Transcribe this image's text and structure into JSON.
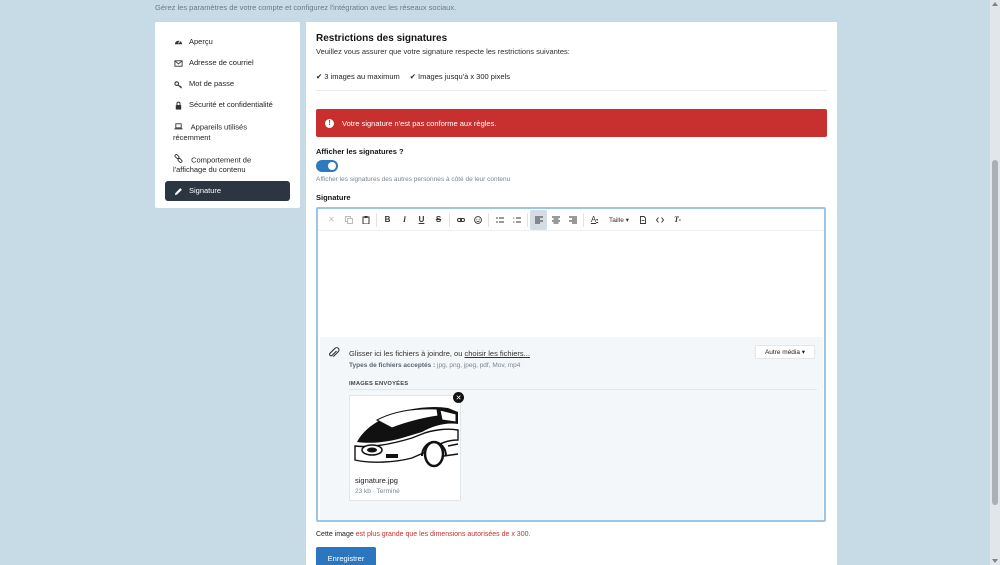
{
  "page": {
    "subtitle": "Gérez les paramètres de votre compte et configurez l'intégration avec les réseaux sociaux."
  },
  "sidebar": {
    "items": [
      {
        "label": "Aperçu",
        "icon": "dashboard-icon"
      },
      {
        "label": "Adresse de courriel",
        "icon": "envelope-icon"
      },
      {
        "label": "Mot de passe",
        "icon": "key-icon"
      },
      {
        "label": "Sécurité et confidentialité",
        "icon": "lock-icon"
      },
      {
        "label": "Appareils utilisés récemment",
        "icon": "laptop-icon"
      },
      {
        "label": "Comportement de l'affichage du contenu",
        "icon": "link-icon"
      },
      {
        "label": "Signature",
        "icon": "pencil-icon",
        "active": true
      }
    ]
  },
  "main": {
    "title": "Restrictions des signatures",
    "intro": "Veuillez vous assurer que votre signature respecte les restrictions suivantes:",
    "rules": [
      "3 images au maximum",
      "Images jusqu'à x 300 pixels"
    ],
    "alert": "Votre signature n'est pas conforme aux règles.",
    "show_label": "Afficher les signatures ?",
    "show_toggle_on": true,
    "show_help": "Afficher les signatures des autres personnes à côté de leur contenu",
    "signature_label": "Signature",
    "toolbar": {
      "size_label": "Taille"
    },
    "attach": {
      "drop_text": "Glisser ici les fichiers à joindre, ou",
      "choose_link": "choisir les fichiers...",
      "types_label": "Types de fichiers acceptés :",
      "types_value": "jpg, png, jpeg, pdf, Mov, mp4",
      "other_media": "Autre média",
      "sent_header": "IMAGES ENVOYÉES",
      "file": {
        "name": "signature.jpg",
        "meta": "23 kb · Terminé"
      }
    },
    "error": {
      "prefix": "Cette image",
      "suffix": "est plus grande que les dimensions autorisées de x 300."
    },
    "save_button": "Enregistrer"
  },
  "colors": {
    "accent": "#2b77bf",
    "danger": "#c8302f",
    "nav_active": "#2b3642"
  }
}
